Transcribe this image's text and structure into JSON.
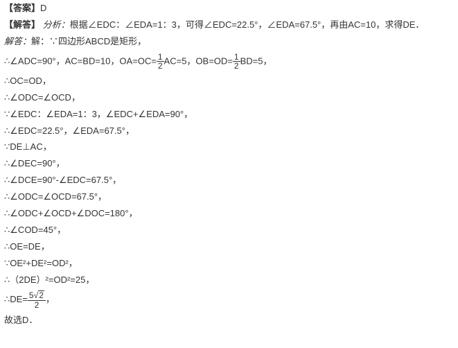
{
  "lines": {
    "l1a": "【答案】",
    "l1b": "D",
    "l2a": "【解答】",
    "l2b": "分析：",
    "l2c": "根据∠EDC：∠EDA=1：3，可得∠EDC=22.5°，∠EDA=67.5°，再由AC=10，求得DE．",
    "l3a": "解答：",
    "l3b": "解：∵四边形ABCD是矩形，",
    "l4a": "∴∠ADC=90°，AC=BD=10，OA=OC=",
    "l4b": "AC=5，OB=OD=",
    "l4c": "BD=5，",
    "l5": "∴OC=OD，",
    "l6": "∴∠ODC=∠OCD，",
    "l7": "∵∠EDC：∠EDA=1：3，∠EDC+∠EDA=90°，",
    "l8": "∴∠EDC=22.5°，∠EDA=67.5°，",
    "l9": "∵DE⊥AC，",
    "l10": "∴∠DEC=90°，",
    "l11": "∴∠DCE=90°-∠EDC=67.5°，",
    "l12": "∴∠ODC=∠OCD=67.5°，",
    "l13": "∴∠ODC+∠OCD+∠DOC=180°，",
    "l14": "∴∠COD=45°，",
    "l15": "∴OE=DE，",
    "l16": "∵OE²+DE²=OD²，",
    "l17": "∴（2DE）²=OD²=25，",
    "l18a": "∴DE=",
    "l18b": "，",
    "l19": "故选D．",
    "frac_half_num": "1",
    "frac_half_den": "2",
    "frac_de_num_a": "5",
    "frac_de_num_b": "2",
    "frac_de_den": "2"
  }
}
